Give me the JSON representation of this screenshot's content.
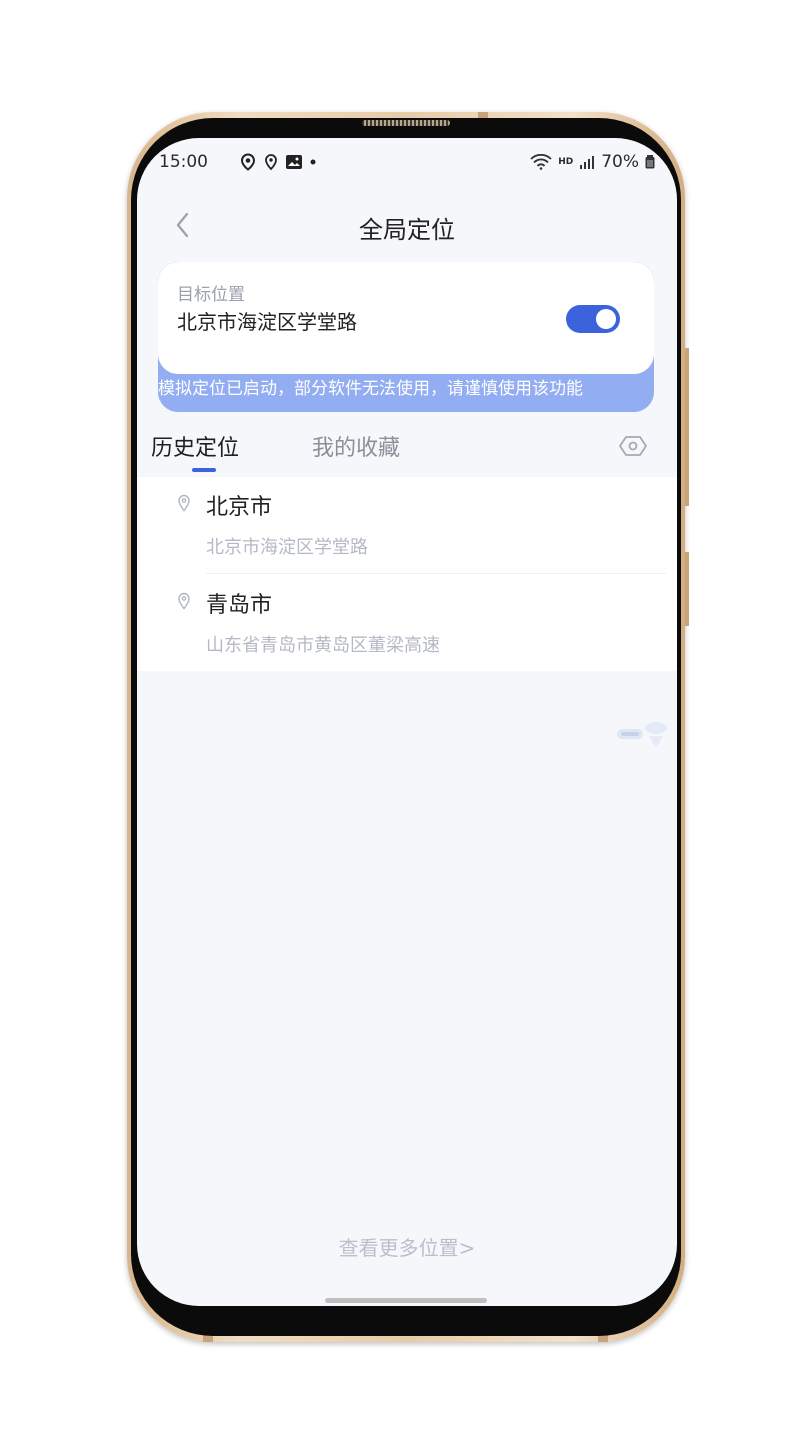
{
  "status_bar": {
    "time": "15:00",
    "battery": "70%",
    "icons_left": [
      "location-icon",
      "location-outline-icon",
      "image-icon",
      "dot-icon"
    ],
    "icons_right": [
      "wifi-icon",
      "hd-icon",
      "signal-icon",
      "battery-icon"
    ],
    "hd_label": "HD"
  },
  "header": {
    "title": "全局定位"
  },
  "target_card": {
    "label": "目标位置",
    "location": "北京市海淀区学堂路",
    "toggle_on": true,
    "warning": "模拟定位已启动，部分软件无法使用，请谨慎使用该功能"
  },
  "tabs": [
    {
      "label": "历史定位",
      "active": true
    },
    {
      "label": "我的收藏",
      "active": false
    }
  ],
  "history": [
    {
      "city": "北京市",
      "address": "北京市海淀区学堂路"
    },
    {
      "city": "青岛市",
      "address": "山东省青岛市黄岛区董梁高速"
    }
  ],
  "more_link": "查看更多位置>",
  "colors": {
    "accent": "#3c63db",
    "warning_bg": "#93adf2",
    "screen_bg": "#f5f7fb"
  }
}
